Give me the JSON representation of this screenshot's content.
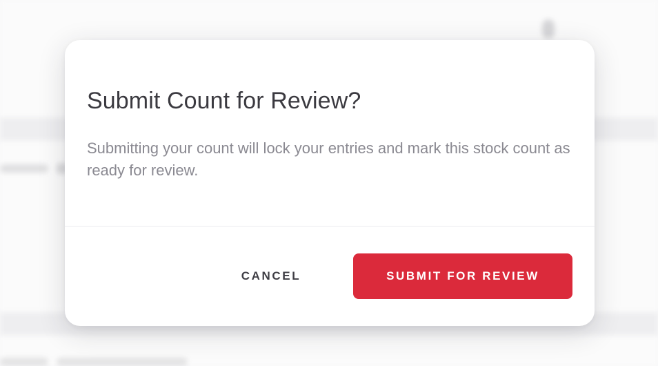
{
  "dialog": {
    "title": "Submit Count for Review?",
    "message": "Submitting your count will lock your entries and mark this stock count as ready for review.",
    "cancel_label": "CANCEL",
    "submit_label": "SUBMIT FOR REVIEW"
  },
  "colors": {
    "primary": "#db2a3b",
    "title_text": "#3b3a40",
    "body_text": "#8a8991",
    "surface": "#ffffff"
  }
}
